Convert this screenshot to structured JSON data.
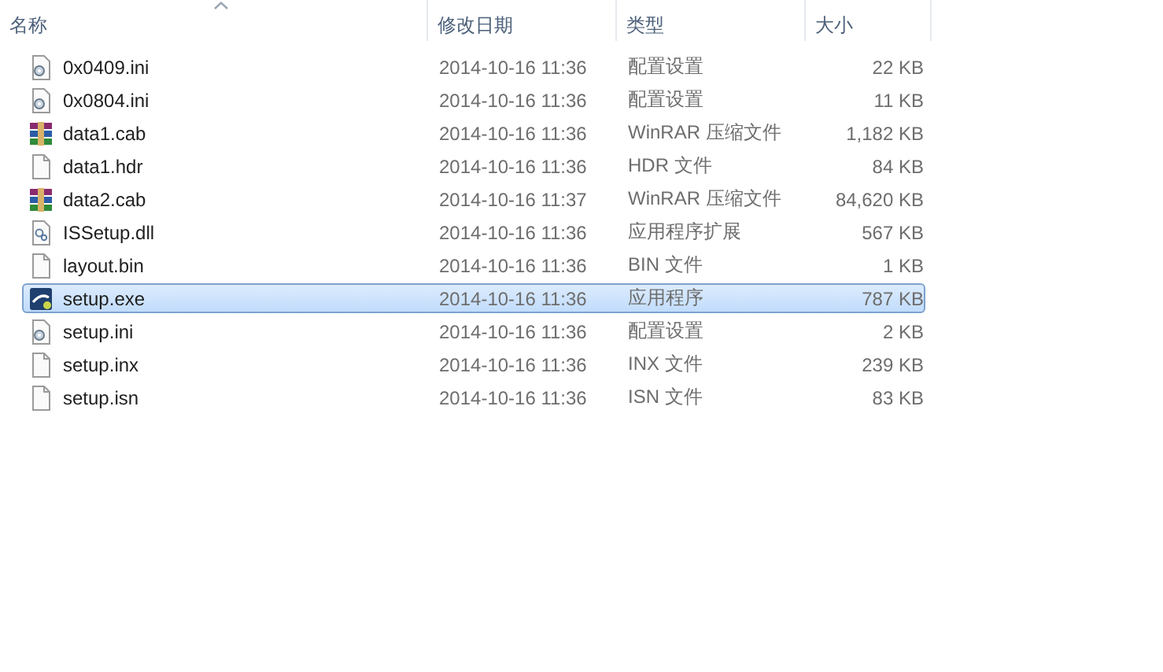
{
  "columns": [
    {
      "label": "名称",
      "sorted": true
    },
    {
      "label": "修改日期",
      "sorted": false
    },
    {
      "label": "类型",
      "sorted": false
    },
    {
      "label": "大小",
      "sorted": false
    }
  ],
  "files": [
    {
      "name": "0x0409.ini",
      "kind": "config",
      "modified": "2014-10-16 11:36",
      "type": "配置设置",
      "size": "22 KB",
      "selected": false
    },
    {
      "name": "0x0804.ini",
      "kind": "config",
      "modified": "2014-10-16 11:36",
      "type": "配置设置",
      "size": "11 KB",
      "selected": false
    },
    {
      "name": "data1.cab",
      "kind": "archive",
      "modified": "2014-10-16 11:36",
      "type": "WinRAR 压缩文件",
      "size": "1,182 KB",
      "selected": false
    },
    {
      "name": "data1.hdr",
      "kind": "file",
      "modified": "2014-10-16 11:36",
      "type": "HDR 文件",
      "size": "84 KB",
      "selected": false
    },
    {
      "name": "data2.cab",
      "kind": "archive",
      "modified": "2014-10-16 11:37",
      "type": "WinRAR 压缩文件",
      "size": "84,620 KB",
      "selected": false
    },
    {
      "name": "ISSetup.dll",
      "kind": "library",
      "modified": "2014-10-16 11:36",
      "type": "应用程序扩展",
      "size": "567 KB",
      "selected": false
    },
    {
      "name": "layout.bin",
      "kind": "file",
      "modified": "2014-10-16 11:36",
      "type": "BIN 文件",
      "size": "1 KB",
      "selected": false
    },
    {
      "name": "setup.exe",
      "kind": "program",
      "modified": "2014-10-16 11:36",
      "type": "应用程序",
      "size": "787 KB",
      "selected": true
    },
    {
      "name": "setup.ini",
      "kind": "config",
      "modified": "2014-10-16 11:36",
      "type": "配置设置",
      "size": "2 KB",
      "selected": false
    },
    {
      "name": "setup.inx",
      "kind": "file",
      "modified": "2014-10-16 11:36",
      "type": "INX 文件",
      "size": "239 KB",
      "selected": false
    },
    {
      "name": "setup.isn",
      "kind": "file",
      "modified": "2014-10-16 11:36",
      "type": "ISN 文件",
      "size": "83 KB",
      "selected": false
    }
  ]
}
